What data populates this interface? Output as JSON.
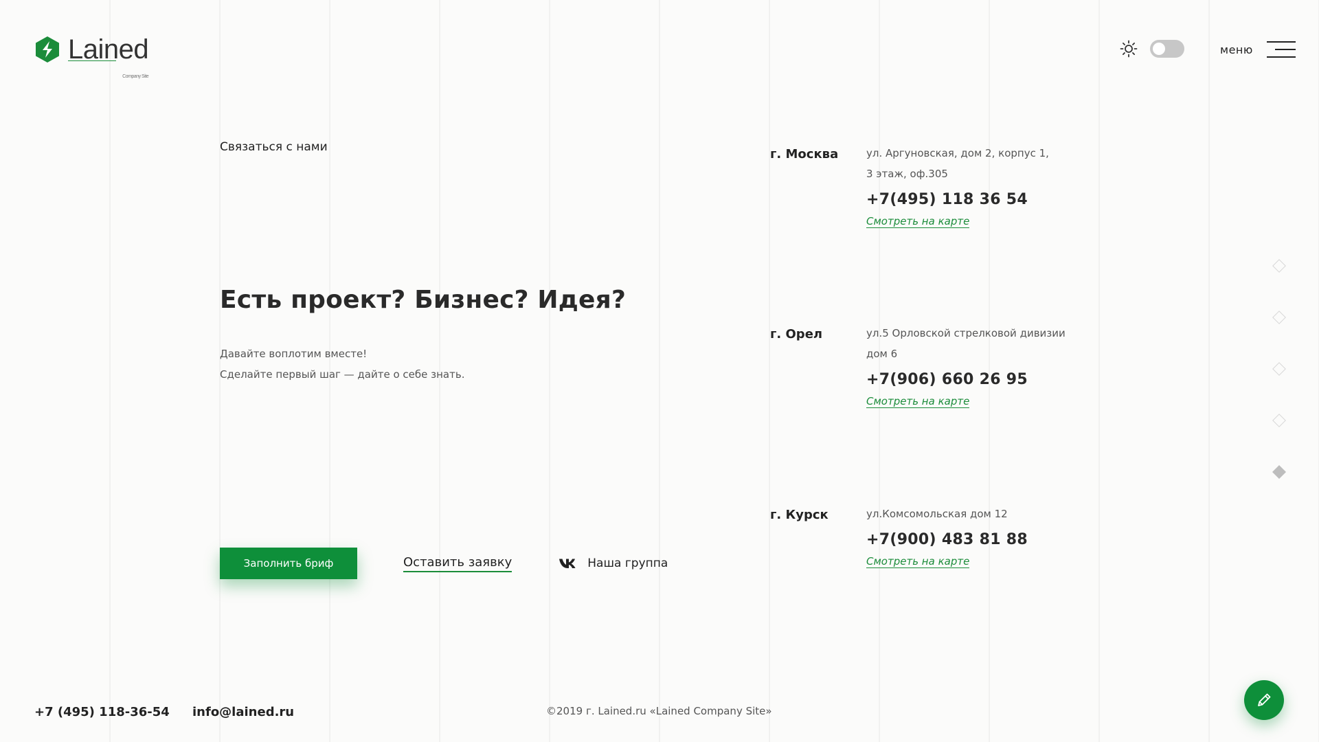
{
  "brand": {
    "name": "Lained",
    "subtitle": "Company Site",
    "accent": "#0e8f3a"
  },
  "header": {
    "theme_icon": "sun-icon",
    "theme_toggle_on": false,
    "menu_label": "меню",
    "menu_icon": "hamburger-icon"
  },
  "contact": {
    "section_label": "Связаться с нами",
    "headline": "Есть проект? Бизнес? Идея?",
    "lead": [
      "Давайте воплотим вместе!",
      "Сделайте первый шаг — дайте о себе знать."
    ],
    "actions": {
      "brief_button": "Заполнить бриф",
      "request_link": "Оставить заявку",
      "vk_icon": "vk-icon",
      "vk_label": "Наша группа"
    }
  },
  "offices": [
    {
      "city": "г. Москва",
      "address": [
        "ул. Аргуновская, дом 2, корпус 1,",
        "3 этаж, оф.305"
      ],
      "phone": "+7(495) 118 36 54",
      "map_link": "Смотреть на карте"
    },
    {
      "city": "г. Орел",
      "address": [
        "ул.5 Орловской стрелковой дивизии",
        "дом 6"
      ],
      "phone": "+7(906) 660 26 95",
      "map_link": "Смотреть на карте"
    },
    {
      "city": "г. Курск",
      "address": [
        "ул.Комсомольская дом 12"
      ],
      "phone": "+7(900) 483 81 88",
      "map_link": "Смотреть на карте"
    }
  ],
  "pager": {
    "count": 5,
    "active_index": 4
  },
  "footer": {
    "phone": "+7 (495) 118-36-54",
    "email": "info@lained.ru",
    "copyright": "©2019 г. Lained.ru «Lained Company Site»",
    "fab_icon": "pencil-icon"
  }
}
